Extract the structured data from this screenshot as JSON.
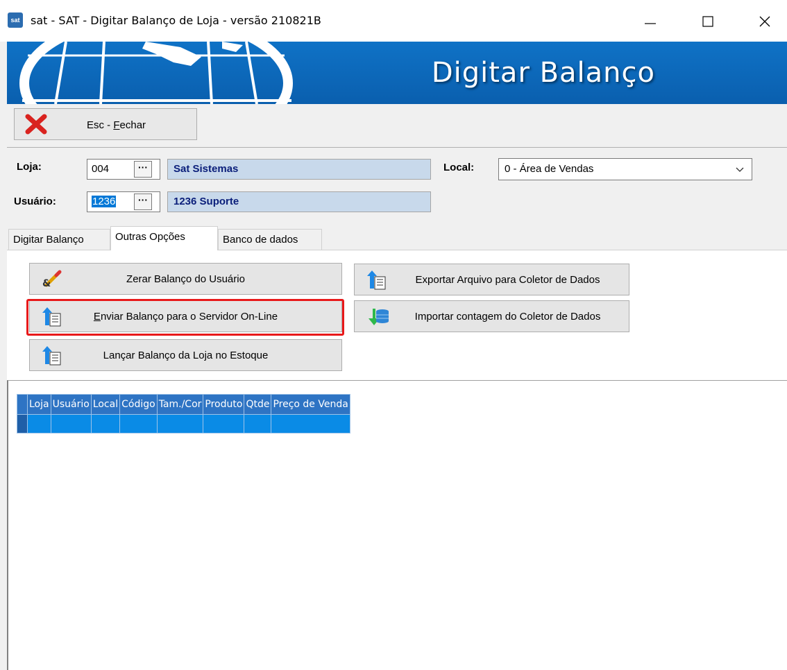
{
  "window": {
    "app_icon": "sat",
    "title": "sat - SAT - Digitar Balanço de Loja - versão 210821B"
  },
  "banner": {
    "title": "Digitar Balanço"
  },
  "toolbar": {
    "close_label_prefix": "Esc - ",
    "close_label_access": "F",
    "close_label_rest": "echar"
  },
  "form": {
    "loja_label": "Loja:",
    "loja_code": "004",
    "loja_name": "Sat Sistemas",
    "usuario_label": "Usuário:",
    "usuario_code": "1236",
    "usuario_name": "1236 Suporte",
    "local_label": "Local:",
    "local_value": "0 - Área de Vendas",
    "lookup_label": "···"
  },
  "tabs": [
    {
      "label": "Digitar Balanço"
    },
    {
      "label": "Outras Opções"
    },
    {
      "label": "Banco de dados"
    }
  ],
  "actions": {
    "zerar": "Zerar Balanço do Usuário",
    "enviar_access": "E",
    "enviar_rest": "nviar Balanço para o Servidor On-Line",
    "lancar": "Lançar Balanço da Loja no Estoque",
    "exportar": "Exportar Arquivo para Coletor de Dados",
    "importar": "Importar contagem do Coletor de Dados"
  },
  "grid": {
    "columns": [
      "Loja",
      "Usuário",
      "Local",
      "Código",
      "Tam./Cor",
      "Produto",
      "Qtde",
      "Preço de Venda"
    ]
  },
  "colors": {
    "banner": "#0f72c6",
    "highlight": "#e8191a",
    "grid_header": "#2e74c4",
    "grid_row_selected": "#0a8be6"
  }
}
